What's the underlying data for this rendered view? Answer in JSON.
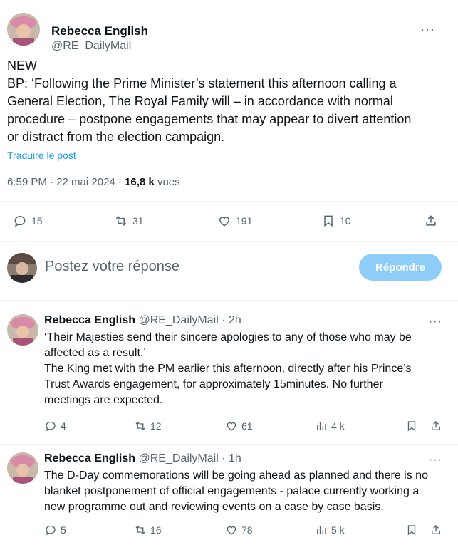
{
  "main_tweet": {
    "author_name": "Rebecca English",
    "author_handle": "@RE_DailyMail",
    "more": "···",
    "text_lines": [
      "NEW",
      "BP: ‘Following the Prime Minister’s statement this afternoon calling a",
      "General Election, The Royal Family will – in accordance with normal",
      "procedure – postpone engagements that may appear to divert attention",
      "or distract from the election campaign."
    ],
    "translate": "Traduire le post",
    "time": "6:59 PM · 22 mai 2024 · ",
    "views_count": "16,8 k",
    "views_label": " vues",
    "stats": {
      "replies": "15",
      "reposts": "31",
      "likes": "191",
      "bookmarks": "10"
    }
  },
  "reply_box": {
    "placeholder": "Postez votre réponse",
    "button": "Répondre",
    "button_color": "#8ecdf8"
  },
  "replies": [
    {
      "name": "Rebecca English",
      "handle": "@RE_DailyMail · 2h",
      "text_lines": [
        "‘Their Majesties send their sincere apologies to any of those who may be",
        "affected as a result.’",
        "The King met with the PM earlier this afternoon, directly after his Prince’s",
        "Trust Awards engagement, for approximately 15minutes. No further",
        "meetings are expected."
      ],
      "stats": {
        "replies": "4",
        "reposts": "12",
        "likes": "61",
        "views": "4 k"
      }
    },
    {
      "name": "Rebecca English",
      "handle": "@RE_DailyMail · 1h",
      "text_lines": [
        "The D-Day commemorations will be going ahead as planned and there is no",
        "blanket postponement of official engagements - palace currently working a",
        "new programme out and reviewing events on a case by case basis."
      ],
      "stats": {
        "replies": "5",
        "reposts": "16",
        "likes": "78",
        "views": "5 k"
      }
    }
  ],
  "colors": {
    "text": "#0f1419",
    "secondary": "#536471",
    "link": "#1d9bf0",
    "divider": "#eff3f4"
  },
  "icons": [
    "reply-icon",
    "repost-icon",
    "like-icon",
    "bookmark-icon",
    "share-icon",
    "views-icon",
    "more-icon"
  ]
}
